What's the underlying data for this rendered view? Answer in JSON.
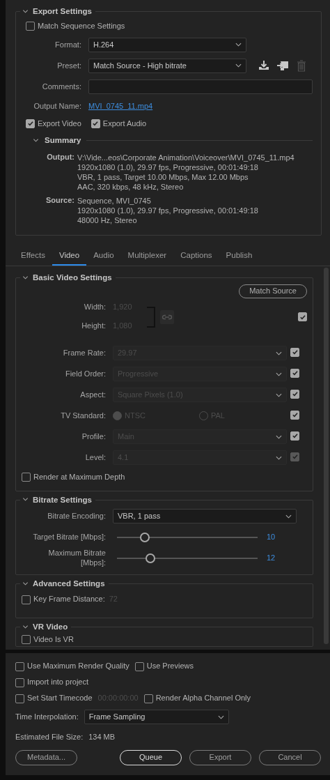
{
  "export_settings": {
    "title": "Export Settings",
    "expanded": true,
    "match_sequence": {
      "label": "Match Sequence Settings",
      "checked": false
    },
    "format": {
      "label": "Format:",
      "value": "H.264"
    },
    "preset": {
      "label": "Preset:",
      "value": "Match Source - High bitrate"
    },
    "comments": {
      "label": "Comments:"
    },
    "output_name": {
      "label": "Output Name:",
      "value": "MVI_0745_11.mp4"
    },
    "export_checks": [
      {
        "label": "Export Video",
        "checked": true
      },
      {
        "label": "Export Audio",
        "checked": true
      }
    ],
    "summary": {
      "title": "Summary",
      "expanded": true,
      "groups": [
        {
          "label": "Output:",
          "lines": [
            "V:\\Vide...eos\\Corporate Animation\\Voiceover\\MVI_0745_11.mp4",
            "1920x1080 (1.0), 29.97 fps, Progressive, 00:01:49:18",
            "VBR, 1 pass, Target 10.00 Mbps, Max 12.00 Mbps",
            "AAC, 320 kbps, 48 kHz, Stereo"
          ]
        },
        {
          "label": "Source:",
          "lines": [
            "Sequence, MVI_0745",
            "1920x1080 (1.0), 29.97 fps, Progressive, 00:01:49:18",
            "48000 Hz, Stereo"
          ]
        }
      ]
    }
  },
  "tabs": [
    {
      "label": "Effects",
      "selected": false
    },
    {
      "label": "Video",
      "selected": true
    },
    {
      "label": "Audio",
      "selected": false
    },
    {
      "label": "Multiplexer",
      "selected": false
    },
    {
      "label": "Captions",
      "selected": false
    },
    {
      "label": "Publish",
      "selected": false
    }
  ],
  "basic_video": {
    "title": "Basic Video Settings",
    "expanded": true,
    "match_source": "Match Source",
    "width": {
      "label": "Width:",
      "value": "1,920"
    },
    "height": {
      "label": "Height:",
      "value": "1,080"
    },
    "size_checked": true,
    "rows": [
      {
        "kind": "select",
        "label": "Frame Rate:",
        "value": "29.97",
        "checked": true,
        "check_disabled": false
      },
      {
        "kind": "select",
        "label": "Field Order:",
        "value": "Progressive",
        "checked": true,
        "check_disabled": false
      },
      {
        "kind": "select",
        "label": "Aspect:",
        "value": "Square Pixels (1.0)",
        "checked": true,
        "check_disabled": false
      },
      {
        "kind": "radio",
        "label": "TV Standard:",
        "options": [
          {
            "label": "NTSC",
            "selected": true
          },
          {
            "label": "PAL",
            "selected": false
          }
        ],
        "checked": true,
        "check_disabled": false
      },
      {
        "kind": "select",
        "label": "Profile:",
        "value": "Main",
        "checked": true,
        "check_disabled": false
      },
      {
        "kind": "select",
        "label": "Level:",
        "value": "4.1",
        "checked": true,
        "check_disabled": true
      }
    ],
    "render_max_depth": {
      "label": "Render at Maximum Depth",
      "checked": false
    }
  },
  "bitrate": {
    "title": "Bitrate Settings",
    "expanded": true,
    "encoding": {
      "label": "Bitrate Encoding:",
      "value": "VBR, 1 pass"
    },
    "sliders": [
      {
        "label": "Target Bitrate [Mbps]:",
        "level": 0.2,
        "reading": "10"
      },
      {
        "label": "Maximum Bitrate [Mbps]:",
        "level": 0.24,
        "reading": "12"
      }
    ]
  },
  "advanced": {
    "title": "Advanced Settings",
    "expanded": true,
    "key_frame": {
      "label": "Key Frame Distance:",
      "checked": false,
      "value": "72"
    }
  },
  "vr_video": {
    "title": "VR Video",
    "expanded": true,
    "video_is_vr": {
      "label": "Video Is VR",
      "checked": false
    }
  },
  "bottom": {
    "option_rows": [
      [
        {
          "label": "Use Maximum Render Quality",
          "checked": false
        },
        {
          "label": "Use Previews",
          "checked": false
        }
      ],
      [
        {
          "label": "Import into project",
          "checked": false
        }
      ],
      [
        {
          "label": "Set Start Timecode",
          "checked": false,
          "value": "00:00:00:00"
        },
        {
          "label": "Render Alpha Channel Only",
          "checked": false
        }
      ]
    ],
    "time_interpolation": {
      "label": "Time Interpolation:",
      "value": "Frame Sampling"
    },
    "file_size": {
      "label": "Estimated File Size:",
      "value": "134 MB"
    },
    "buttons": [
      {
        "label": "Metadata...",
        "default": false
      },
      {
        "label": "Queue",
        "default": true
      },
      {
        "label": "Export",
        "default": false
      },
      {
        "label": "Cancel",
        "default": false
      }
    ]
  }
}
